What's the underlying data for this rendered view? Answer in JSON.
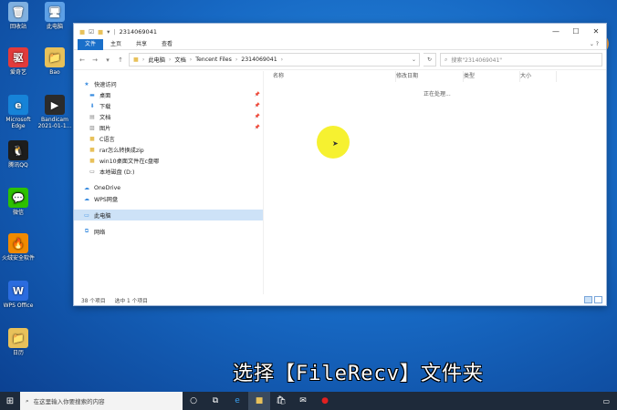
{
  "desktop": {
    "icons": [
      {
        "label": "回收站",
        "color": "#7fb0e0",
        "glyph": "🗑"
      },
      {
        "label": "此电脑",
        "color": "#5da0e6",
        "glyph": "🖥"
      },
      {
        "label": "爱奇艺",
        "color": "#e23b3b",
        "glyph": "驱"
      },
      {
        "label": "Bao",
        "color": "#e8c15a",
        "glyph": "📁"
      },
      {
        "label": "Microsoft Edge",
        "color": "#1683d8",
        "glyph": "e"
      },
      {
        "label": "Bandicam 2021-01-1...",
        "color": "#2b2b2b",
        "glyph": "▶"
      },
      {
        "label": "腾讯QQ",
        "color": "#1d1d1d",
        "glyph": "🐧"
      },
      {
        "label": "微信",
        "color": "#2dc100",
        "glyph": "💬"
      },
      {
        "label": "火绒安全软件",
        "color": "#f08a00",
        "glyph": "🔥"
      },
      {
        "label": "WPS Office",
        "color": "#2b6cdf",
        "glyph": "W"
      },
      {
        "label": "日历",
        "color": "#e8c15a",
        "glyph": "📁"
      }
    ]
  },
  "window": {
    "title": "2314069041",
    "ribbon_tabs": [
      "文件",
      "主页",
      "共享",
      "查看"
    ],
    "breadcrumb": [
      "此电脑",
      "文档",
      "Tencent Files",
      "2314069041"
    ],
    "search_placeholder": "搜索\"2314069041\"",
    "nav_pane": [
      {
        "label": "快速访问",
        "icon": "star-icon",
        "color": "#3b8de0",
        "pinned": false,
        "group": "quick"
      },
      {
        "label": "桌面",
        "icon": "desktop-icon",
        "color": "#3b8de0",
        "pinned": true
      },
      {
        "label": "下载",
        "icon": "download-icon",
        "color": "#3b8de0",
        "pinned": true
      },
      {
        "label": "文档",
        "icon": "document-icon",
        "color": "#8a8a8a",
        "pinned": true
      },
      {
        "label": "图片",
        "icon": "picture-icon",
        "color": "#8a8a8a",
        "pinned": true
      },
      {
        "label": "C语言",
        "icon": "folder-icon",
        "color": "#e8c15a",
        "pinned": false
      },
      {
        "label": "rar怎么转换成zip",
        "icon": "folder-icon",
        "color": "#e8c15a",
        "pinned": false
      },
      {
        "label": "win10桌面文件在c盘哪",
        "icon": "folder-icon",
        "color": "#e8c15a",
        "pinned": false
      },
      {
        "label": "本地磁盘 (D:)",
        "icon": "drive-icon",
        "color": "#666666",
        "pinned": false
      },
      {
        "label": "OneDrive",
        "icon": "cloud-icon",
        "color": "#3b8de0",
        "pinned": false
      },
      {
        "label": "WPS网盘",
        "icon": "cloud-icon",
        "color": "#3b8de0",
        "pinned": false
      },
      {
        "label": "此电脑",
        "icon": "computer-icon",
        "color": "#3b8de0",
        "pinned": false,
        "selected": true
      },
      {
        "label": "网络",
        "icon": "network-icon",
        "color": "#3b8de0",
        "pinned": false
      }
    ],
    "columns": [
      "名称",
      "修改日期",
      "类型",
      "大小"
    ],
    "processing_text": "正在处理...",
    "status_items": "38 个项目",
    "status_selected": "选中 1 个项目"
  },
  "subtitle": "选择【FileRecv】文件夹",
  "taskbar": {
    "search_placeholder": "在这里输入你要搜索的内容"
  }
}
